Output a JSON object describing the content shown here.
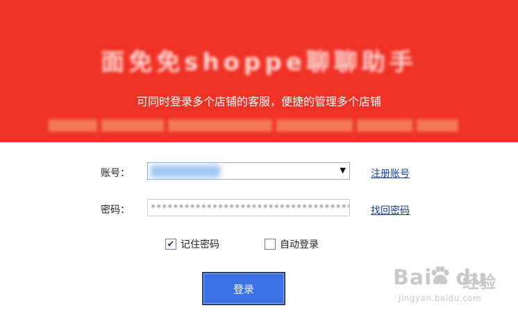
{
  "banner": {
    "title": "面免免shoppe聊聊助手",
    "subtitle": "可同时登录多个店铺的客服，便捷的管理多个店铺",
    "note": "",
    "colors": {
      "background": "#ef3226",
      "text": "#ffffff"
    }
  },
  "form": {
    "account_label": "账号：",
    "account_value": "",
    "account_dropdown_icon": "triangle-down-icon",
    "password_label": "密码：",
    "password_value": "••••••••••••••••••••••••••••••••••••••••",
    "register_link": "注册账号",
    "forgot_link": "找回密码",
    "remember_label": "记住密码",
    "remember_checked": true,
    "auto_login_label": "自动登录",
    "auto_login_checked": false,
    "login_button": "登录",
    "colors": {
      "button": "#3d72e6",
      "link": "#1a3d9c"
    }
  },
  "watermark": {
    "brand": "Bai",
    "brand_icon": "paw-icon",
    "brand_tail": "du",
    "cn": "经验",
    "url": "jingyan.baidu.com"
  }
}
